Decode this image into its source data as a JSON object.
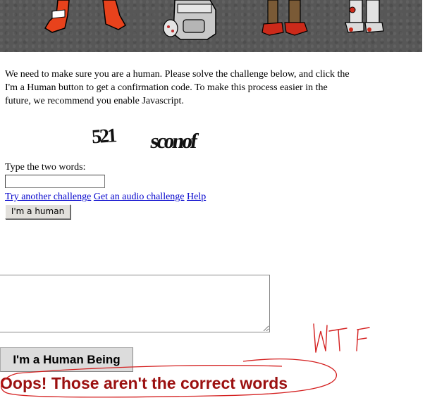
{
  "intro": {
    "text": "We need to make sure you are a human. Please solve the challenge below, and click the I'm a Human button to get a confirmation code. To make this process easier in the future, we recommend you enable Javascript."
  },
  "captcha": {
    "word1": "521",
    "word2": "sconof"
  },
  "form": {
    "type_label": "Type the two words:",
    "answer_value": "",
    "links": {
      "another": "Try another challenge",
      "audio": "Get an audio challenge",
      "help": "Help"
    },
    "human_button": "I'm a human"
  },
  "lower": {
    "human_being_button": "I'm a Human Being",
    "error": "Oops! Those aren't the correct words",
    "annotation": "WTF"
  },
  "colors": {
    "banner": "#575757",
    "link": "#0000cc",
    "error": "#9b1010",
    "scribble": "#d42020"
  }
}
